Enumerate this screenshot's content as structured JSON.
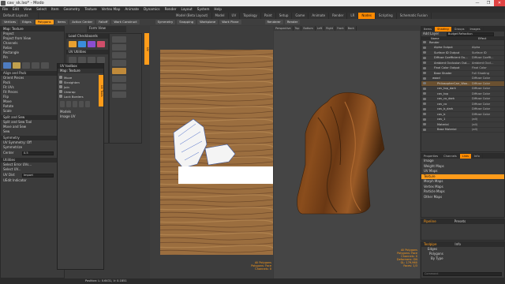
{
  "title": "cav_sk.lxo* - Modo",
  "menu": [
    "File",
    "Edit",
    "View",
    "Select",
    "Item",
    "Geometry",
    "Texture",
    "Vertex Map",
    "Animate",
    "Dynamics",
    "Render",
    "Layout",
    "System",
    "Help"
  ],
  "window_buttons": [
    "—",
    "❐",
    "✕"
  ],
  "layout_select": "Default Layouts",
  "mode_tabs": [
    "Model (Beta Layout)",
    "Model",
    "UV",
    "Topology",
    "Paint",
    "Setup",
    "Game",
    "Animate",
    "Render",
    "LR",
    "Nodes",
    "Scripting",
    "Schematic Fusion"
  ],
  "active_mode_tab": "Nodes",
  "toolbar": {
    "buttons": [
      "Vertices",
      "Edges",
      "Polygons",
      "Items",
      "Action Center",
      "Falloff",
      "Work Construct",
      "Symmetry",
      "Snapping",
      "Workplane",
      "Work Plane",
      "Renderer",
      "Render"
    ],
    "active": "Polygons"
  },
  "left_panel": {
    "header": "Map: Texture",
    "rows": [
      "Project",
      "Project from View",
      "Channels",
      "Relax",
      "Rectangle",
      "Pin"
    ],
    "section2": [
      "Align and Pack",
      "Orient Pieces",
      "Pack",
      "Fit UVs",
      "Fit Pieces",
      "Flip",
      "Move",
      "Rotate",
      "Scale"
    ],
    "section3": [
      "Split and Sew",
      "Split and Sew Tool",
      "Move and Sew",
      "Sew"
    ],
    "section4": [
      "Symmetry",
      "UV Symmetry: Off",
      "Symmetrize"
    ],
    "center_label": "Center",
    "center_value": "0.5",
    "section5": [
      "Utilities",
      "Select Error UVs...",
      "Select UV..."
    ],
    "uv_dist_label": "UV Dist",
    "uv_dist_value": "Import",
    "uedit_label": "UEdit Indicator"
  },
  "load_checkerboard": "Load Checkboards",
  "form_view": "Form View",
  "uv_utilities": "UV Utilities",
  "uv_toolbox": {
    "title": "UV toolbox",
    "header": "Map: Texture",
    "items": [
      "Move",
      "Straighten",
      "Join",
      "Unwrap",
      "Lock Borders"
    ],
    "vtab": "UV Tools",
    "sub_items": [
      "Models",
      "Image UV"
    ]
  },
  "uv_view": {
    "tab": "UV",
    "status_lines": [
      "All Polygons",
      "Polygons: Face",
      "Channels: 0"
    ],
    "position_readout": "Position: L: 0.6431, V: 0.1851"
  },
  "viewport": {
    "tabs": [
      "Perspective",
      "Top",
      "Bottom",
      "Left",
      "Right",
      "Front",
      "Back"
    ],
    "status_lines": [
      "All Polygons",
      "Polygons: Face",
      "Channels: 0",
      "Deformers: ON",
      "GL: 179,960",
      "Faces: 1/3"
    ]
  },
  "shader_tree": {
    "tabs": [
      "Items",
      "Shading",
      "Groups",
      "Images"
    ],
    "active_tab": "Shading",
    "filter_label": "Add Layer",
    "filter_value": "Budget Refraction",
    "columns": [
      "Name",
      "Effect"
    ],
    "rows": [
      {
        "name": "Render",
        "effect": ""
      },
      {
        "name": "Alpha Output",
        "effect": "Alpha"
      },
      {
        "name": "Surface ID Output",
        "effect": "Surface ID"
      },
      {
        "name": "Diffuse Coefficient Ou...",
        "effect": "Diffuse Coeffi..."
      },
      {
        "name": "Ambient Occlusion Out...",
        "effect": "Ambient Occl..."
      },
      {
        "name": "Final Color Output",
        "effect": "Final Color"
      },
      {
        "name": "Base Shader",
        "effect": "Full Shading"
      },
      {
        "name": "wood",
        "effect": "Diffuse Color"
      },
      {
        "name": "PhilosopherCarr_Woo...",
        "effect": "Diffuse Color"
      },
      {
        "name": "cav_top_dark",
        "effect": "Diffuse Color"
      },
      {
        "name": "cav_top",
        "effect": "Diffuse Color"
      },
      {
        "name": "cav_co_dark",
        "effect": "Diffuse Color"
      },
      {
        "name": "cav_co",
        "effect": "Diffuse Color"
      },
      {
        "name": "cav_b_dark",
        "effect": "Diffuse Color"
      },
      {
        "name": "cav_b",
        "effect": "Diffuse Color"
      },
      {
        "name": "cav_1",
        "effect": "(all)"
      },
      {
        "name": "Material",
        "effect": "(all)"
      },
      {
        "name": "Base Material",
        "effect": "(all)"
      }
    ]
  },
  "properties": {
    "tabs": [
      "Properties",
      "Channels",
      "Lists",
      "Info"
    ],
    "active_tab": "Lists",
    "rows": [
      "Image",
      "Weight Maps",
      "UV Maps",
      "Texture",
      "Morph Maps",
      "Vertex Maps",
      "Particle Maps",
      "Other Maps"
    ],
    "header_row": "Texture"
  },
  "pipeline": {
    "title": "Pipeline",
    "tab": "Presets"
  },
  "toolpipe": {
    "title": "Toolpipe",
    "tab": "Info",
    "rows": [
      "Edges",
      "Polygons",
      "By Type"
    ],
    "command_placeholder": "Command"
  }
}
